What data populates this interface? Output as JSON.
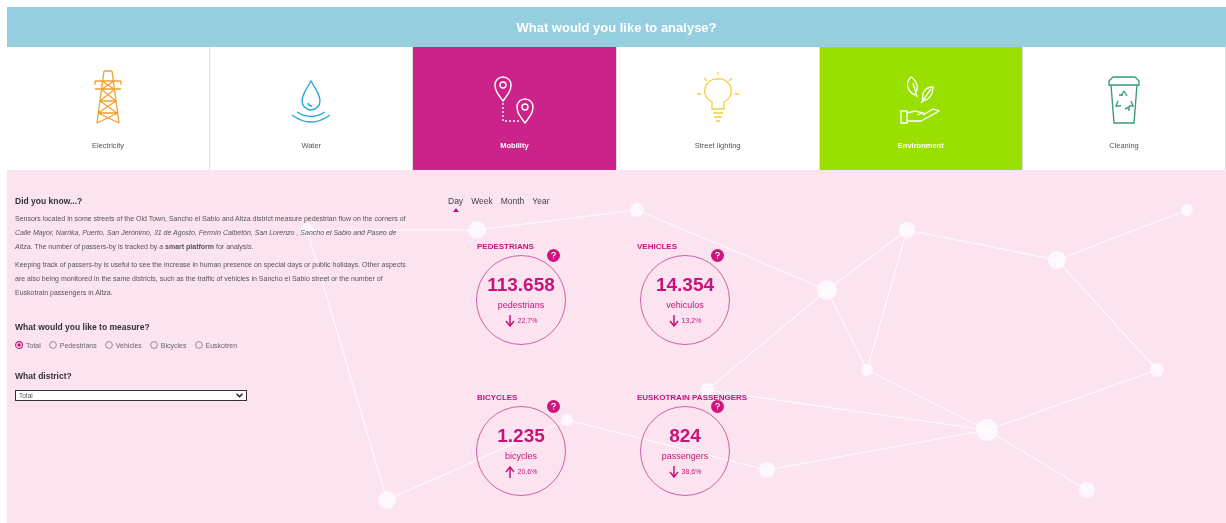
{
  "header": {
    "title": "What would you like to analyse?"
  },
  "categories": [
    {
      "label": "Electricity",
      "kind": "electricity",
      "selected": false,
      "highlighted": false
    },
    {
      "label": "Water",
      "kind": "water",
      "selected": false,
      "highlighted": false
    },
    {
      "label": "Mobility",
      "kind": "mobility",
      "selected": true,
      "highlighted": false
    },
    {
      "label": "Street lighting",
      "kind": "lighting",
      "selected": false,
      "highlighted": false
    },
    {
      "label": "Environment",
      "kind": "environment",
      "selected": false,
      "highlighted": true
    },
    {
      "label": "Cleaning",
      "kind": "cleaning",
      "selected": false,
      "highlighted": false
    }
  ],
  "info": {
    "title": "Did you know...?",
    "paragraphs": [
      "Sensors located in some streets of  the Old Town, Sancho el Sabio and Altza district measure pedestrian flow on the corners of *Calle Mayor, Narrika, Puerto, San Jerónimo, 31 de Agosto, Fermín Calbetón, San Lorenzo , Sancho el Sabio and Paseo de Altza.* The number of passers-by is tracked by a **smart platform** for analysis.",
      "Keeping track of passers-by is useful to see the increase in human presence on special days or public holidays. Other aspects are also being monitored in the same districts, such as the traffic of vehicles in Sancho el Sabio street or the number of Euskotrain passengers in Altza."
    ]
  },
  "measure": {
    "title": "What would you like to measure?",
    "options": [
      {
        "label": "Total",
        "selected": true
      },
      {
        "label": "Pedestrians",
        "selected": false
      },
      {
        "label": "Vehicles",
        "selected": false
      },
      {
        "label": "Bicycles",
        "selected": false
      },
      {
        "label": "Euskotren",
        "selected": false
      }
    ]
  },
  "district": {
    "title": "What district?",
    "value": "Total"
  },
  "periods": [
    {
      "label": "Day",
      "selected": true
    },
    {
      "label": "Week",
      "selected": false
    },
    {
      "label": "Month",
      "selected": false
    },
    {
      "label": "Year",
      "selected": false
    }
  ],
  "stats": [
    {
      "title": "PEDESTRIANS",
      "value": "113.658",
      "unit": "pedestrians",
      "change": "22,7%",
      "kind": "decrease"
    },
    {
      "title": "VEHICLES",
      "value": "14.354",
      "unit": "vehiculos",
      "change": "13,2%",
      "kind": "decrease"
    },
    {
      "title": "BICYCLES",
      "value": "1.235",
      "unit": "bicycles",
      "change": "20,6%",
      "kind": "increase"
    },
    {
      "title": "EUSKOTRAIN PASSENGERS",
      "value": "824",
      "unit": "passengers",
      "change": "38,6%",
      "kind": "decrease"
    }
  ]
}
